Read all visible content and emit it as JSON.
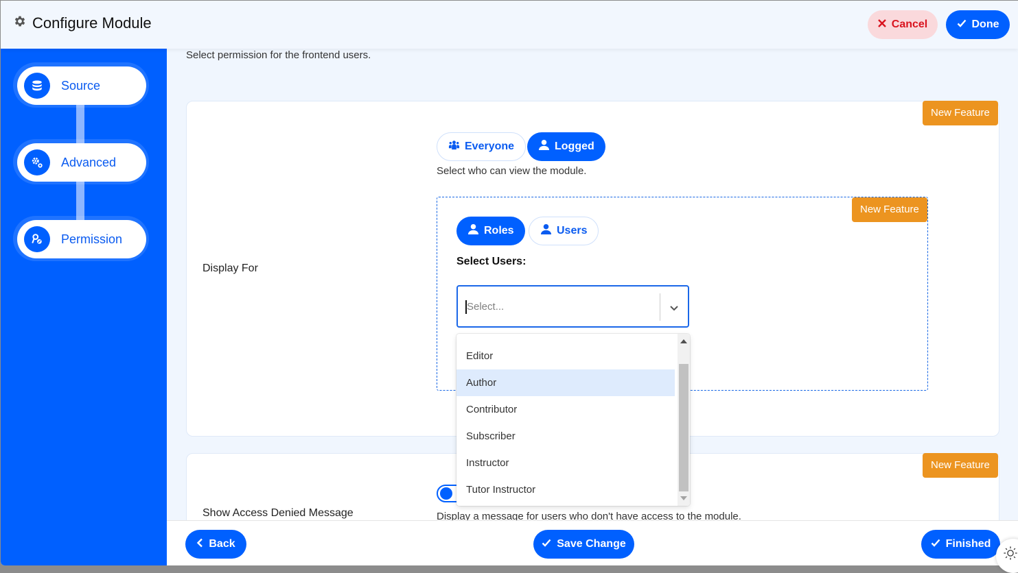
{
  "header": {
    "title": "Configure Module",
    "cancel_label": "Cancel",
    "done_label": "Done"
  },
  "sidebar": {
    "steps": [
      {
        "label": "Source",
        "icon": "database-icon"
      },
      {
        "label": "Advanced",
        "icon": "gears-icon"
      },
      {
        "label": "Permission",
        "icon": "key-icon"
      }
    ]
  },
  "main": {
    "intro": "Select permission for the frontend users.",
    "display_for": {
      "label": "Display For",
      "badge": "New Feature",
      "audience_options": [
        {
          "label": "Everyone",
          "icon": "users-icon",
          "active": false
        },
        {
          "label": "Logged",
          "icon": "user-icon",
          "active": true
        }
      ],
      "audience_hint": "Select who can view the module.",
      "inner": {
        "badge": "New Feature",
        "mode_options": [
          {
            "label": "Roles",
            "icon": "user-icon",
            "active": true
          },
          {
            "label": "Users",
            "icon": "user-icon",
            "active": false
          }
        ],
        "select_label": "Select Users:",
        "select_placeholder": "Select...",
        "dropdown_options": [
          "Editor",
          "Author",
          "Contributor",
          "Subscriber",
          "Instructor",
          "Tutor Instructor"
        ],
        "highlighted_option": "Author"
      }
    },
    "access_denied": {
      "label": "Show Access Denied Message",
      "badge": "New Feature",
      "toggle_on": true,
      "hint": "Display a message for users who don't have access to the module."
    }
  },
  "footer": {
    "back_label": "Back",
    "save_label": "Save Change",
    "finished_label": "Finished"
  },
  "colors": {
    "primary": "#0060ff",
    "badge": "#ec9420",
    "cancel_bg": "#fad9dc",
    "cancel_text": "#d9141f",
    "highlight": "#deebfd"
  }
}
